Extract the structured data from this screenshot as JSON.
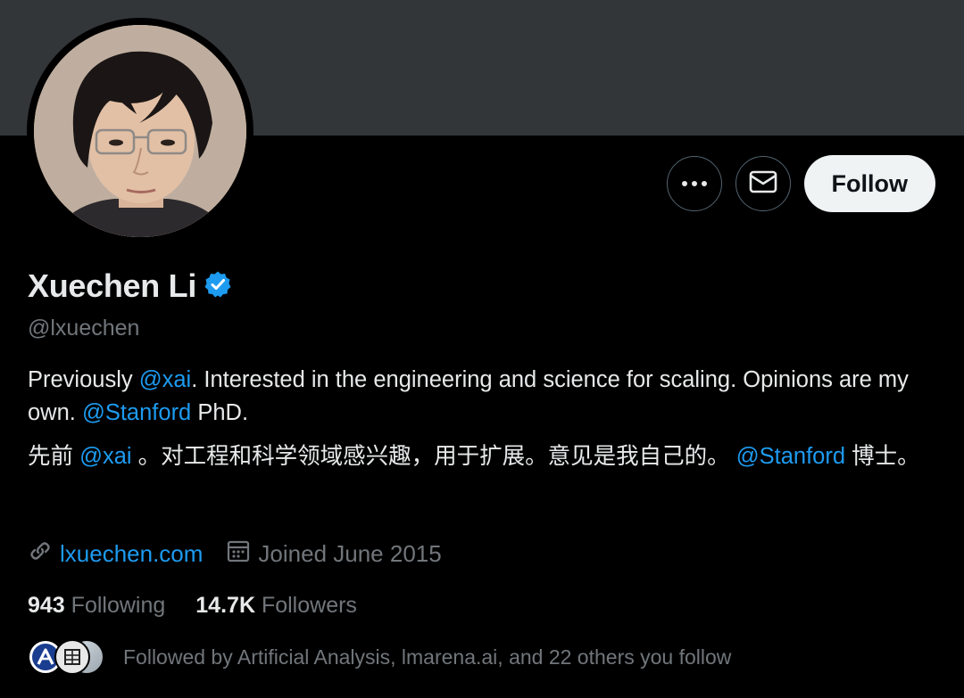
{
  "profile": {
    "name": "Xuechen Li",
    "handle": "@lxuechen",
    "verified": true,
    "bio": {
      "en_part1": "Previously ",
      "en_mention1": "@xai",
      "en_part2": ". Interested in the engineering and science for scaling. Opinions are my own. ",
      "en_mention2": "@Stanford",
      "en_part3": " PhD.",
      "cn_part1": "先前 ",
      "cn_mention1": "@xai",
      "cn_part2": " 。对工程和科学领域感兴趣，用于扩展。意见是我自己的。 ",
      "cn_mention2": "@Stanford",
      "cn_part3": " 博士。"
    },
    "website": "lxuechen.com",
    "joined": "Joined June 2015"
  },
  "actions": {
    "more_icon": "more-icon",
    "message_icon": "envelope-icon",
    "follow_label": "Follow"
  },
  "stats": {
    "following_count": "943",
    "following_label": "Following",
    "followers_count": "14.7K",
    "followers_label": "Followers"
  },
  "followed_by": {
    "text": "Followed by Artificial Analysis, lmarena.ai, and 22 others you follow",
    "avatar_icons": [
      "artificial-analysis-logo",
      "lmarena-logo",
      "user-avatar"
    ]
  },
  "colors": {
    "background": "#000000",
    "banner": "#333639",
    "link": "#1d9bf0",
    "muted": "#71767b",
    "text": "#e7e9ea",
    "follow_button": "#eff3f4",
    "verified_badge": "#1d9bf0"
  }
}
